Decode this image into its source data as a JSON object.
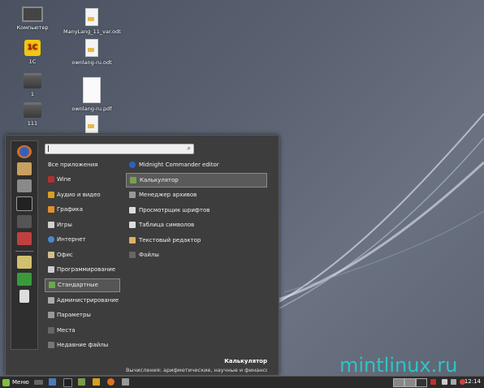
{
  "desktop": {
    "icons": [
      {
        "label": "Компьютер",
        "type": "monitor"
      },
      {
        "label": "ManyLang_11_var.odt",
        "type": "doc"
      },
      {
        "label": "1C",
        "type": "onec"
      },
      {
        "label": "ownlang-ru.odt",
        "type": "doc"
      },
      {
        "label": "1",
        "type": "folder"
      },
      {
        "label": "ownlang-ru.pdf",
        "type": "pdf"
      },
      {
        "label": "111",
        "type": "folder"
      }
    ],
    "watermark": "mintlinux.ru"
  },
  "menu": {
    "search": {
      "value": "",
      "placeholder": ""
    },
    "favorites": [
      "firefox-icon",
      "package-icon",
      "tools-icon",
      "terminal-icon",
      "folder-icon",
      "software-icon",
      "display-icon",
      "logout-icon",
      "shutdown-icon"
    ],
    "categories": [
      {
        "label": "Все приложения",
        "color": "transparent"
      },
      {
        "label": "Wine",
        "color": "#b03030"
      },
      {
        "label": "Аудио и видео",
        "color": "#d8a020"
      },
      {
        "label": "Графика",
        "color": "#e09030"
      },
      {
        "label": "Игры",
        "color": "#d0d0d0"
      },
      {
        "label": "Интернет",
        "color": "#4a8ad0"
      },
      {
        "label": "Офис",
        "color": "#d0c090"
      },
      {
        "label": "Программирование",
        "color": "#cccccc"
      },
      {
        "label": "Стандартные",
        "color": "#6aaa4a"
      },
      {
        "label": "Администрирование",
        "color": "#aaaaaa"
      },
      {
        "label": "Параметры",
        "color": "#999999"
      },
      {
        "label": "Места",
        "color": "#666666"
      },
      {
        "label": "Недавние файлы",
        "color": "#777777"
      }
    ],
    "selected_category": "Стандартные",
    "apps": [
      {
        "label": "Midnight Commander editor",
        "color": "#3060c0"
      },
      {
        "label": "Калькулятор",
        "color": "#7aa04a"
      },
      {
        "label": "Менеджер архивов",
        "color": "#999999"
      },
      {
        "label": "Просмотрщик шрифтов",
        "color": "#dddddd"
      },
      {
        "label": "Таблица символов",
        "color": "#dddddd"
      },
      {
        "label": "Текстовый редактор",
        "color": "#e0b060"
      },
      {
        "label": "Файлы",
        "color": "#666666"
      }
    ],
    "selected_app": "Калькулятор",
    "description": {
      "title": "Калькулятор",
      "text": "Вычисления: арифметические, научные и финансовые"
    }
  },
  "panel": {
    "menu_label": "Меню",
    "clock": "12:14",
    "launchers": [
      "show-desktop-icon",
      "files-icon",
      "terminal-icon",
      "folder-icon",
      "firefox-icon",
      "calculator-icon",
      "package-icon"
    ]
  }
}
